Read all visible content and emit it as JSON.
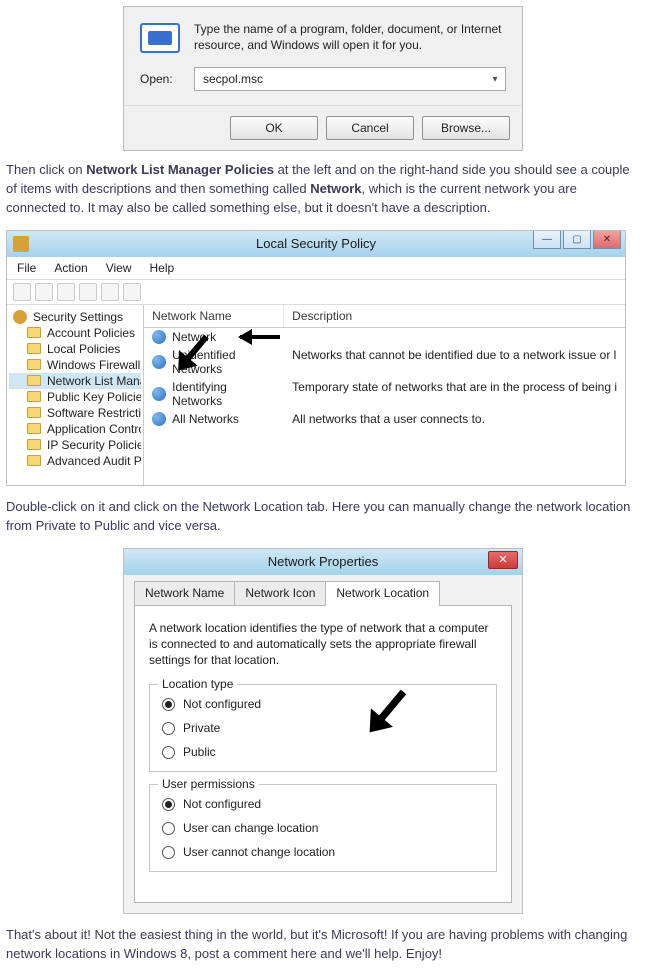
{
  "run": {
    "description": "Type the name of a program, folder, document, or Internet resource, and Windows will open it for you.",
    "open_label": "Open:",
    "value": "secpol.msc",
    "buttons": {
      "ok": "OK",
      "cancel": "Cancel",
      "browse": "Browse..."
    }
  },
  "para1": {
    "a": "Then click on ",
    "b": "Network List Manager Policies",
    "c": " at the left and on the right-hand side you should see a couple of items with descriptions and then something called ",
    "d": "Network",
    "e": ", which is the current network you are connected to. It may also be called something else, but it doesn't have a description."
  },
  "lsp": {
    "title": "Local Security Policy",
    "menu": [
      "File",
      "Action",
      "View",
      "Help"
    ],
    "tree_root": "Security Settings",
    "tree": [
      "Account Policies",
      "Local Policies",
      "Windows Firewall with Advanced Secu",
      "Network List Manager Policies",
      "Public Key Policies",
      "Software Restriction Policies",
      "Application Control Policies",
      "IP Security Policies on Local Compute",
      "Advanced Audit Policy Configuration"
    ],
    "tree_selected_index": 3,
    "cols": {
      "name": "Network Name",
      "desc": "Description"
    },
    "rows": [
      {
        "name": "Network",
        "desc": ""
      },
      {
        "name": "Unidentified Networks",
        "desc": "Networks that cannot be identified due to a network issue or l"
      },
      {
        "name": "Identifying Networks",
        "desc": "Temporary state of networks that are in the process of being i"
      },
      {
        "name": "All Networks",
        "desc": "All networks that a user connects to."
      }
    ]
  },
  "para2": "Double-click on it and click on the Network Location tab. Here you can manually change the network location from Private to Public and vice versa.",
  "np": {
    "title": "Network Properties",
    "tabs": [
      "Network Name",
      "Network Icon",
      "Network Location"
    ],
    "active_tab_index": 2,
    "desc": "A network location identifies the type of network that a computer is connected to and automatically sets the appropriate firewall settings for that location.",
    "location": {
      "legend": "Location type",
      "options": [
        "Not configured",
        "Private",
        "Public"
      ],
      "selected_index": 0
    },
    "perms": {
      "legend": "User permissions",
      "options": [
        "Not configured",
        "User can change location",
        "User cannot change location"
      ],
      "selected_index": 0
    }
  },
  "para3": "That's about it! Not the easiest thing in the world, but it's Microsoft! If you are having problems with changing network locations in Windows 8, post a comment here and we'll help. Enjoy!"
}
